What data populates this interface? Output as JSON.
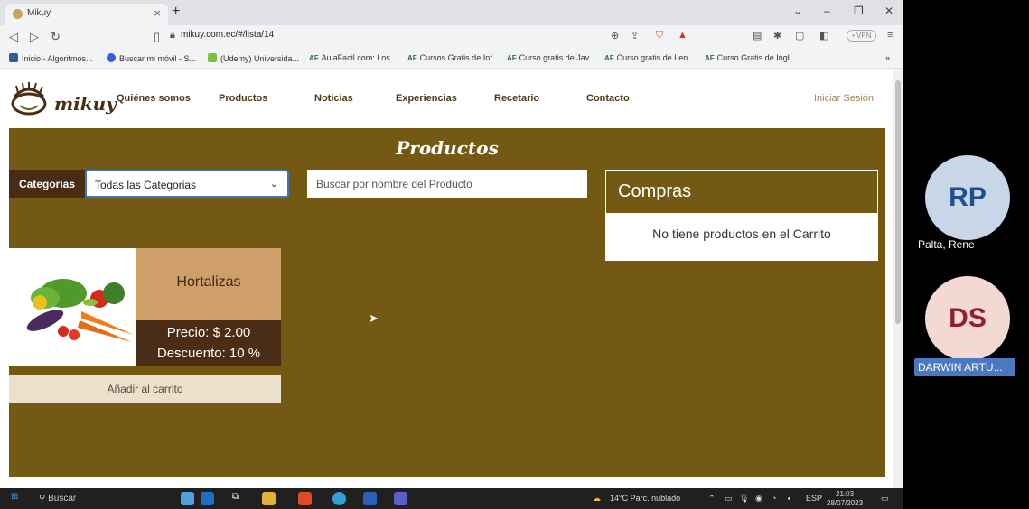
{
  "browser": {
    "tab_title": "Mikuy",
    "new_tab": "+",
    "url": "mikuy.com.ec/#/lista/14",
    "vpn": "• VPN",
    "bookmarks": [
      "Inicio - Algoritmos...",
      "Buscar mi móvil - S...",
      "(Udemy) Universida...",
      "AulaFacil.com: Los...",
      "Cursos Gratis de Inf...",
      "Curso gratis de Jav...",
      "Curso gratis de Len...",
      "Curso Gratis de Ingl..."
    ],
    "af_mark": "AF",
    "more": "»"
  },
  "site": {
    "logo": "mikuy",
    "nav": [
      "Quiénes somos",
      "Productos",
      "Noticias",
      "Experiencias",
      "Recetario",
      "Contacto"
    ],
    "login": "Iniciar Sesión"
  },
  "products": {
    "title": "Productos",
    "category_label": "Categorias",
    "category_selected": "Todas las Categorias",
    "search_placeholder": "Buscar por nombre del Producto",
    "cart_title": "Compras",
    "cart_empty": "No tiene productos en el Carrito",
    "items": [
      {
        "name": "Hortalizas",
        "price": "Precio: $ 2.00",
        "discount": "Descuento: 10 %",
        "add": "Añadir al carrito"
      }
    ]
  },
  "taskbar": {
    "search": "Buscar",
    "weather": "14°C  Parc. nublado",
    "lang": "ESP",
    "time": "21:03",
    "date": "28/07/2023"
  },
  "participants": [
    {
      "initials": "RP",
      "name": "Palta, Rene",
      "color": "#1f4f8f"
    },
    {
      "initials": "DS",
      "name": "DARWIN ARTU...",
      "color": "#8f1f2f"
    }
  ]
}
